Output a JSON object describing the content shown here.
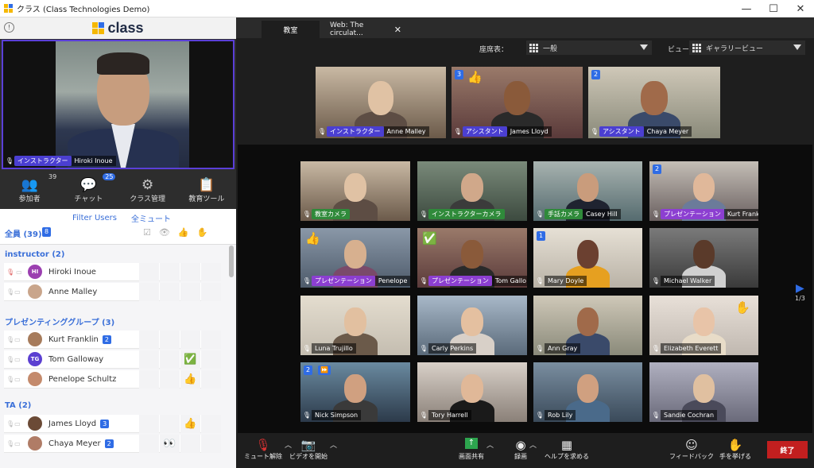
{
  "window": {
    "title": "クラス (Class Technologies Demo)",
    "controls": [
      "—",
      "☐",
      "✕"
    ]
  },
  "brand": {
    "name": "class"
  },
  "host": {
    "role": "インストラクター",
    "name": "Hiroki Inoue"
  },
  "tools": [
    {
      "label": "参加者",
      "count": "39",
      "icon": "participants-icon"
    },
    {
      "label": "チャット",
      "count": "25",
      "icon": "chat-icon"
    },
    {
      "label": "クラス管理",
      "count": "",
      "icon": "class-manage-icon"
    },
    {
      "label": "教育ツール",
      "count": "",
      "icon": "teaching-tools-icon"
    }
  ],
  "roster": {
    "filter_label": "Filter Users",
    "mute_all_label": "全ミュート",
    "all_label": "全員 (39)",
    "all_badge": "8",
    "groups": [
      {
        "title": "instructor (2)",
        "members": [
          {
            "name": "Hiroki Inoue",
            "initials": "HI",
            "avatar_color": "#9b3fb0",
            "badge": "",
            "emoji": ""
          },
          {
            "name": "Anne Malley",
            "initials": "",
            "avatar_color": "#c9a58b",
            "badge": "",
            "emoji": ""
          }
        ]
      },
      {
        "title": "プレゼンティンググループ (3)",
        "members": [
          {
            "name": "Kurt Franklin",
            "initials": "",
            "avatar_color": "#a67b5b",
            "badge": "2",
            "emoji": ""
          },
          {
            "name": "Tom Galloway",
            "initials": "TG",
            "avatar_color": "#5b3fd1",
            "badge": "",
            "emoji": "✅"
          },
          {
            "name": "Penelope Schultz",
            "initials": "",
            "avatar_color": "#c48a6c",
            "badge": "",
            "emoji": "👍"
          }
        ]
      },
      {
        "title": "TA (2)",
        "members": [
          {
            "name": "James Lloyd",
            "initials": "",
            "avatar_color": "#6b4a36",
            "badge": "3",
            "emoji": "👍"
          },
          {
            "name": "Chaya Meyer",
            "initials": "",
            "avatar_color": "#b07c66",
            "badge": "2",
            "emoji": "👀"
          }
        ]
      }
    ]
  },
  "tabs": [
    {
      "label": "教室"
    },
    {
      "label": "Web: The circulat..."
    }
  ],
  "options": {
    "seating_label": "座席表：",
    "seating_value": "一般",
    "view_label": "ビュー：",
    "view_value": "ギャラリービュー"
  },
  "top_tiles": [
    {
      "role": "インストラクター",
      "name": "Anne Malley",
      "badge": "",
      "emoji": ""
    },
    {
      "role": "アシスタント",
      "name": "James Lloyd",
      "badge": "3",
      "emoji": "👍"
    },
    {
      "role": "アシスタント",
      "name": "Chaya Meyer",
      "badge": "2",
      "emoji": ""
    }
  ],
  "grid_tiles": [
    {
      "role": "教室カメラ",
      "name": "",
      "badge": "",
      "emoji": ""
    },
    {
      "role": "インストラクターカメラ",
      "name": "",
      "badge": "",
      "emoji": ""
    },
    {
      "role": "手話カメラ",
      "name": "Casey Hill",
      "badge": "",
      "emoji": ""
    },
    {
      "role": "プレゼンテーション",
      "name": "Kurt Frank",
      "badge": "2",
      "emoji": ""
    },
    {
      "role": "プレゼンテーション",
      "name": "Penelope",
      "badge": "",
      "emoji": "👍"
    },
    {
      "role": "プレゼンテーション",
      "name": "Tom Gallo",
      "badge": "",
      "emoji": "✅"
    },
    {
      "role": "",
      "name": "Mary Doyle",
      "badge": "1",
      "emoji": ""
    },
    {
      "role": "",
      "name": "Michael Walker",
      "badge": "",
      "emoji": ""
    },
    {
      "role": "",
      "name": "Luna Trujillo",
      "badge": "",
      "emoji": ""
    },
    {
      "role": "",
      "name": "Carly Perkins",
      "badge": "",
      "emoji": ""
    },
    {
      "role": "",
      "name": "Ann Gray",
      "badge": "",
      "emoji": ""
    },
    {
      "role": "",
      "name": "Elizabeth Everett",
      "badge": "",
      "emoji": "✋"
    },
    {
      "role": "",
      "name": "Nick Simpson",
      "badge": "2",
      "emoji": "⏩"
    },
    {
      "role": "",
      "name": "Tory Harrell",
      "badge": "",
      "emoji": ""
    },
    {
      "role": "",
      "name": "Rob Lily",
      "badge": "",
      "emoji": ""
    },
    {
      "role": "",
      "name": "Sandie Cochran",
      "badge": "",
      "emoji": ""
    }
  ],
  "pager": {
    "label": "1/3"
  },
  "bottom": {
    "unmute": "ミュート解除",
    "start_video": "ビデオを開始",
    "share_screen": "画面共有",
    "record": "録画",
    "help": "ヘルプを求める",
    "feedback": "フィードバック",
    "raise_hand": "手を挙げる",
    "end": "終了"
  }
}
